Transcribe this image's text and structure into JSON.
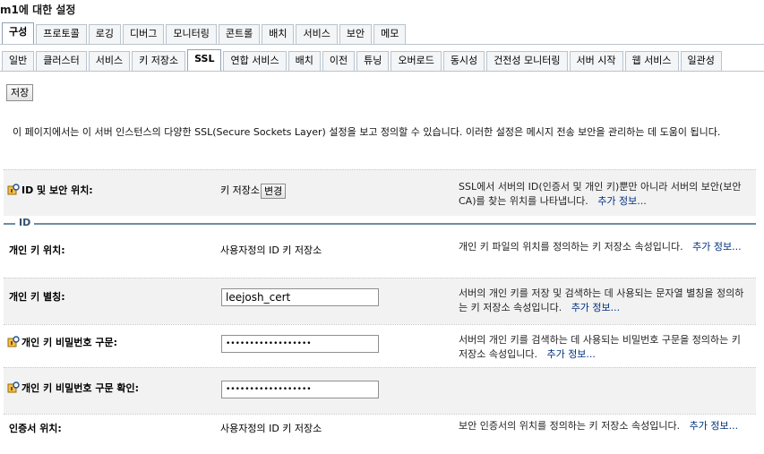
{
  "page": {
    "title": "m1에 대한 설정"
  },
  "tabs_top": [
    "구성",
    "프로토콜",
    "로깅",
    "디버그",
    "모니터링",
    "콘트롤",
    "배치",
    "서비스",
    "보안",
    "메모"
  ],
  "tabs_top_active": "구성",
  "tabs_sub": [
    "일반",
    "클러스터",
    "서비스",
    "키 저장소",
    "SSL",
    "연합 서비스",
    "배치",
    "이전",
    "튜닝",
    "오버로드",
    "동시성",
    "건전성 모니터링",
    "서버 시작",
    "웹 서비스",
    "일관성"
  ],
  "tabs_sub_active": "SSL",
  "toolbar": {
    "save_label": "저장"
  },
  "description": "이 페이지에서는 이 서버 인스턴스의 다양한 SSL(Secure Sockets Layer) 설정을 보고 정의할 수 있습니다. 이러한 설정은 메시지 전송 보안을 관리하는 데 도움이 됩니다.",
  "rows": {
    "identity_location": {
      "label": "ID 및 보안 위치:",
      "value": "키 저장소",
      "button": "변경",
      "help": "SSL에서 서버의 ID(인증서 및 개인 키)뿐만 아니라 서버의 보안(보안 CA)를 찾는 위치를 나타냅니다.",
      "more": "추가 정보..."
    },
    "section_id": "ID",
    "private_key_location": {
      "label": "개인 키 위치:",
      "value": "사용자정의 ID 키 저장소",
      "help": "개인 키 파일의 위치를 정의하는 키 저장소 속성입니다.",
      "more": "추가 정보..."
    },
    "private_key_alias": {
      "label": "개인 키 별칭:",
      "value": "leejosh_cert",
      "help": "서버의 개인 키를 저장 및 검색하는 데 사용되는 문자열 별칭을 정의하는 키 저장소 속성입니다.",
      "more": "추가 정보..."
    },
    "private_key_passphrase": {
      "label": "개인 키 비밀번호 구문:",
      "value": "••••••••••••••••••",
      "help": "서버의 개인 키를 검색하는 데 사용되는 비밀번호 구문을 정의하는 키 저장소 속성입니다.",
      "more": "추가 정보..."
    },
    "confirm_passphrase": {
      "label": "개인 키 비밀번호 구문 확인:",
      "value": "••••••••••••••••••"
    },
    "certificate_location": {
      "label": "인증서 위치:",
      "value": "사용자정의 ID 키 저장소",
      "help": "보안 인증서의 위치를 정의하는 키 저장소 속성입니다.",
      "more": "추가 정보..."
    }
  }
}
